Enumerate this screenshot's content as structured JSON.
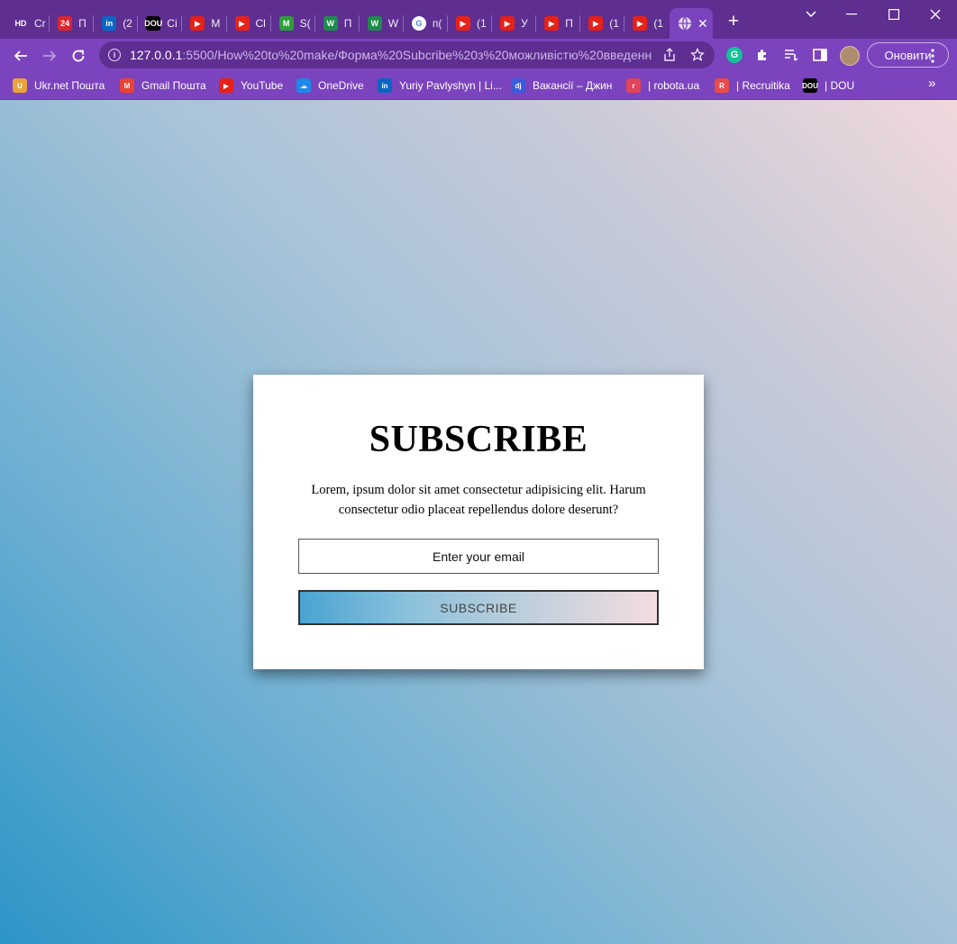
{
  "browser": {
    "tabs": [
      {
        "icon": "hd-icon",
        "title": "Cr",
        "color": "#5e2e91",
        "mark": "HD"
      },
      {
        "icon": "news24-icon",
        "title": "П",
        "color": "#d9262e",
        "mark": "24"
      },
      {
        "icon": "linkedin-icon",
        "title": "(2",
        "color": "#0a66c2",
        "mark": "in"
      },
      {
        "icon": "dou-icon",
        "title": "Ci",
        "color": "#000000",
        "mark": "DOU"
      },
      {
        "icon": "youtube-icon",
        "title": "M",
        "color": "#e62117",
        "mark": "▶"
      },
      {
        "icon": "youtube-icon",
        "title": "Cl",
        "color": "#e62117",
        "mark": "▶"
      },
      {
        "icon": "m-logo-icon",
        "title": "S(",
        "color": "#2e9d3a",
        "mark": "M"
      },
      {
        "icon": "w-logo-icon",
        "title": "П",
        "color": "#1f8a4c",
        "mark": "W"
      },
      {
        "icon": "w-logo-icon",
        "title": "W",
        "color": "#1f8a4c",
        "mark": "W"
      },
      {
        "icon": "google-icon",
        "title": "п(",
        "color": "#ffffff",
        "mark": "G"
      },
      {
        "icon": "youtube-icon",
        "title": "(1",
        "color": "#e62117",
        "mark": "▶"
      },
      {
        "icon": "youtube-icon",
        "title": "У",
        "color": "#e62117",
        "mark": "▶"
      },
      {
        "icon": "youtube-icon",
        "title": "П",
        "color": "#e62117",
        "mark": "▶"
      },
      {
        "icon": "youtube-icon",
        "title": "(1",
        "color": "#e62117",
        "mark": "▶"
      },
      {
        "icon": "youtube-icon",
        "title": "(1",
        "color": "#e62117",
        "mark": "▶"
      }
    ],
    "active_tab": {
      "icon": "globe-icon",
      "close": "✕"
    },
    "new_tab": "+",
    "window_controls": {
      "minimize": "─",
      "maximize": "☐",
      "close": "✕",
      "tab_search": "⌄"
    },
    "url_host": "127.0.0.1",
    "url_rest": ":5500/How%20to%20make/Форма%20Subcribe%20з%20можливістю%20введенн...",
    "update_label": "Оновити",
    "bookmarks": [
      {
        "icon": "ukrnet-icon",
        "label": "Ukr.net Пошта",
        "color": "#e8a33c",
        "mark": "U"
      },
      {
        "icon": "gmail-icon",
        "label": "Gmail Пошта",
        "color": "#ea4335",
        "mark": "M"
      },
      {
        "icon": "youtube-icon",
        "label": "YouTube",
        "color": "#e62117",
        "mark": "▶"
      },
      {
        "icon": "onedrive-icon",
        "label": "OneDrive",
        "color": "#1e88e5",
        "mark": "☁"
      },
      {
        "icon": "linkedin-icon",
        "label": "Yuriy Pavlyshyn | Li...",
        "color": "#0a66c2",
        "mark": "in"
      },
      {
        "icon": "djinni-icon",
        "label": "Вакансії – Джин",
        "color": "#3b5bdb",
        "mark": "dj"
      },
      {
        "icon": "robota-icon",
        "label": "| robota.ua",
        "color": "#e0455a",
        "mark": "r"
      },
      {
        "icon": "recruitika-icon",
        "label": "| Recruitika",
        "color": "#e84b4b",
        "mark": "R"
      },
      {
        "icon": "dou-icon",
        "label": "| DOU",
        "color": "#000000",
        "mark": "DOU"
      }
    ],
    "bookmarks_more": "»"
  },
  "form": {
    "title": "SUBSCRIBE",
    "description": "Lorem, ipsum dolor sit amet consectetur adipisicing elit. Harum consectetur odio placeat repellendus dolore deserunt?",
    "email_placeholder": "Enter your email",
    "button_label": "SUBSCRIBE"
  },
  "colors": {
    "browser_frame": "#5e2e91",
    "toolbar": "#7b43bd",
    "gradient_start": "#2d95c8",
    "gradient_end": "#f1d8dc"
  }
}
